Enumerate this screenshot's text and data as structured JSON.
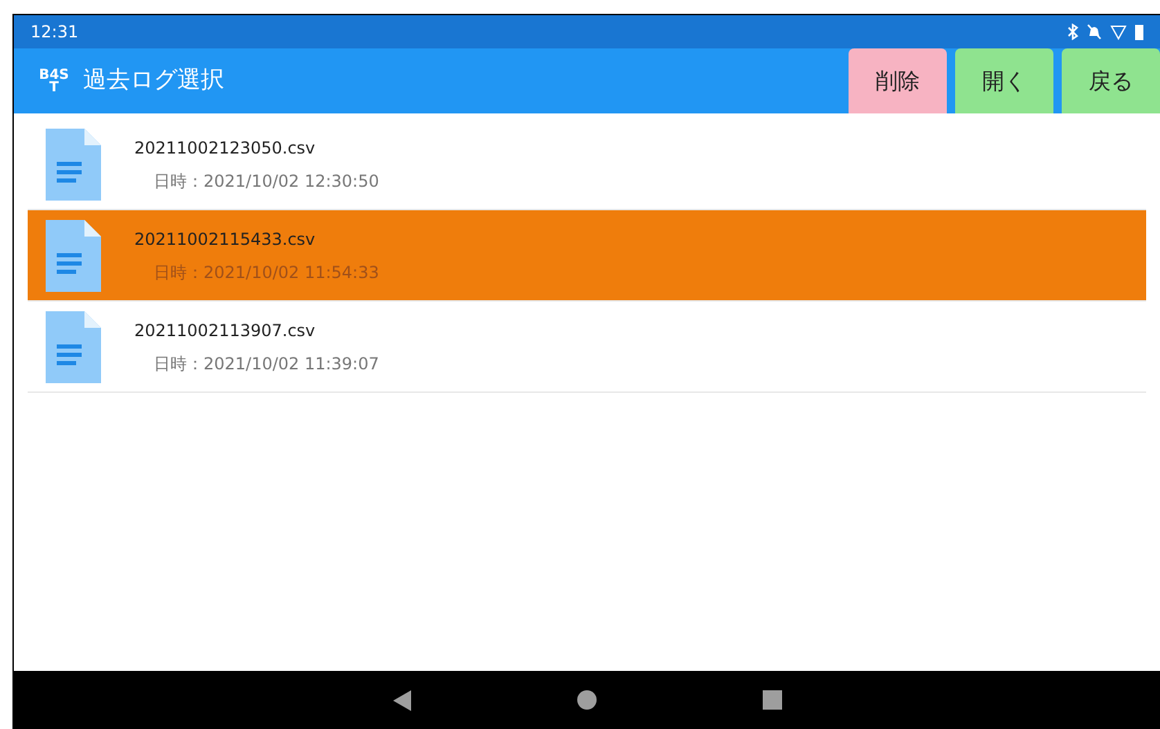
{
  "status_bar": {
    "time": "12:31"
  },
  "app_bar": {
    "logo_top": "B4S",
    "logo_bottom": "T",
    "title": "過去ログ選択"
  },
  "buttons": [
    {
      "label": "削除",
      "kind": "delete"
    },
    {
      "label": "開く",
      "kind": "normal"
    },
    {
      "label": "戻る",
      "kind": "normal"
    }
  ],
  "files": [
    {
      "name": "20211002123050.csv",
      "date": "日時：2021/10/02 12:30:50",
      "selected": false
    },
    {
      "name": "20211002115433.csv",
      "date": "日時：2021/10/02 11:54:33",
      "selected": true
    },
    {
      "name": "20211002113907.csv",
      "date": "日時：2021/10/02 11:39:07",
      "selected": false
    }
  ]
}
